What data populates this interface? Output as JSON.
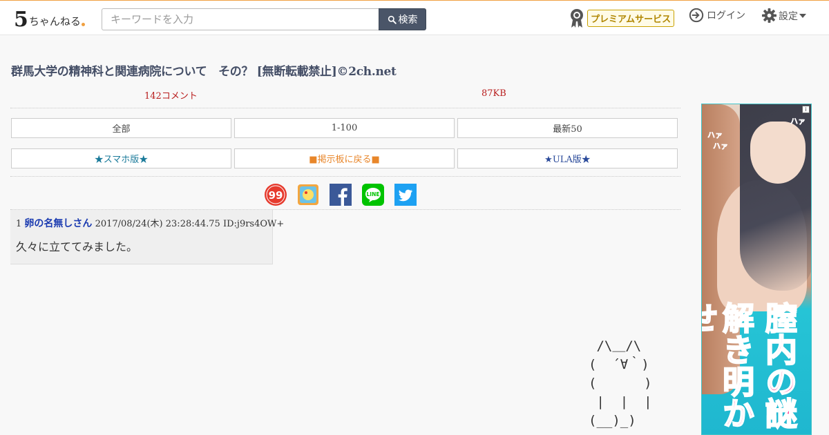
{
  "header": {
    "logo_five": "5",
    "logo_text": "ちゃんねる",
    "search_placeholder": "キーワードを入力",
    "search_label": "検索",
    "premium_label": "プレミアムサービス",
    "login_label": "ログイン",
    "settings_label": "設定"
  },
  "thread": {
    "title": "群馬大学の精神科と関連病院について　その？ [無断転載禁止]©2ch.net",
    "comments": "142コメント",
    "size": "87KB"
  },
  "nav": {
    "all": "全部",
    "range": "1-100",
    "latest": "最新50",
    "smartphone": "★スマホ版★",
    "back_to_board": "■掲示板に戻る■",
    "ula": "★ULA版★"
  },
  "share": {
    "icons": [
      "2ch-sc-icon",
      "bookmark-app-icon",
      "facebook-icon",
      "line-icon",
      "twitter-icon"
    ],
    "colors": {
      "first": "#e63b2e",
      "facebook": "#3b5998",
      "line": "#00c300",
      "twitter": "#1da1f2"
    },
    "line_label": "LINE"
  },
  "post": {
    "number": "1",
    "name": "卵の名無しさん",
    "datetime": "2017/08/24(木) 23:28:44.75",
    "id": "ID:j9rs4OW+",
    "body": "久々に立ててみました。"
  },
  "ascii_art": " /\\＿/\\\n(  ´∀｀)\n(      )\n |  |  |\n(__)_)",
  "ad": {
    "info": "i",
    "text_right": "膣内の謎",
    "text_left": "解き明かせ",
    "ha": "ハァ"
  }
}
